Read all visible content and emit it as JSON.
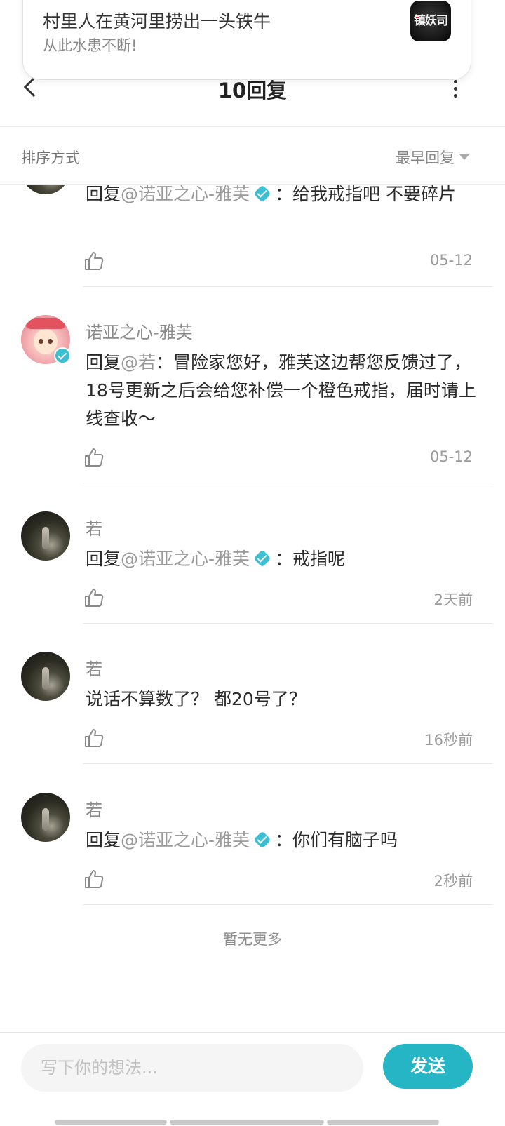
{
  "notification": {
    "title": "村里人在黄河里捞出一头铁牛",
    "body": "从此水患不断!",
    "app_icon_text": "镇妖司"
  },
  "header": {
    "title": "10回复"
  },
  "sort": {
    "label": "排序方式",
    "value": "最早回复"
  },
  "comments": [
    {
      "reply_prefix": "回复",
      "mention": "@诺亚之心-雅芙",
      "text": "：给我戒指吧 不要碎片",
      "time": "05-12"
    },
    {
      "user": "诺亚之心-雅芙",
      "reply_prefix": "回复",
      "mention": "@若",
      "text": "：冒险家您好，雅芙这边帮您反馈过了，18号更新之后会给您补偿一个橙色戒指，届时请上线查收～",
      "time": "05-12"
    },
    {
      "user": "若",
      "reply_prefix": "回复",
      "mention": "@诺亚之心-雅芙",
      "text": "：戒指呢",
      "time": "2天前"
    },
    {
      "user": "若",
      "text": "说话不算数了？ 都20号了？",
      "time": "16秒前"
    },
    {
      "user": "若",
      "reply_prefix": "回复",
      "mention": "@诺亚之心-雅芙",
      "text": "：你们有脑子吗",
      "time": "2秒前"
    }
  ],
  "footer_note": "暂无更多",
  "compose": {
    "placeholder": "写下你的想法...",
    "send_label": "发送"
  },
  "colors": {
    "accent": "#26b5c5",
    "verified": "#3bbfd2",
    "mention": "#9a9a9a"
  }
}
